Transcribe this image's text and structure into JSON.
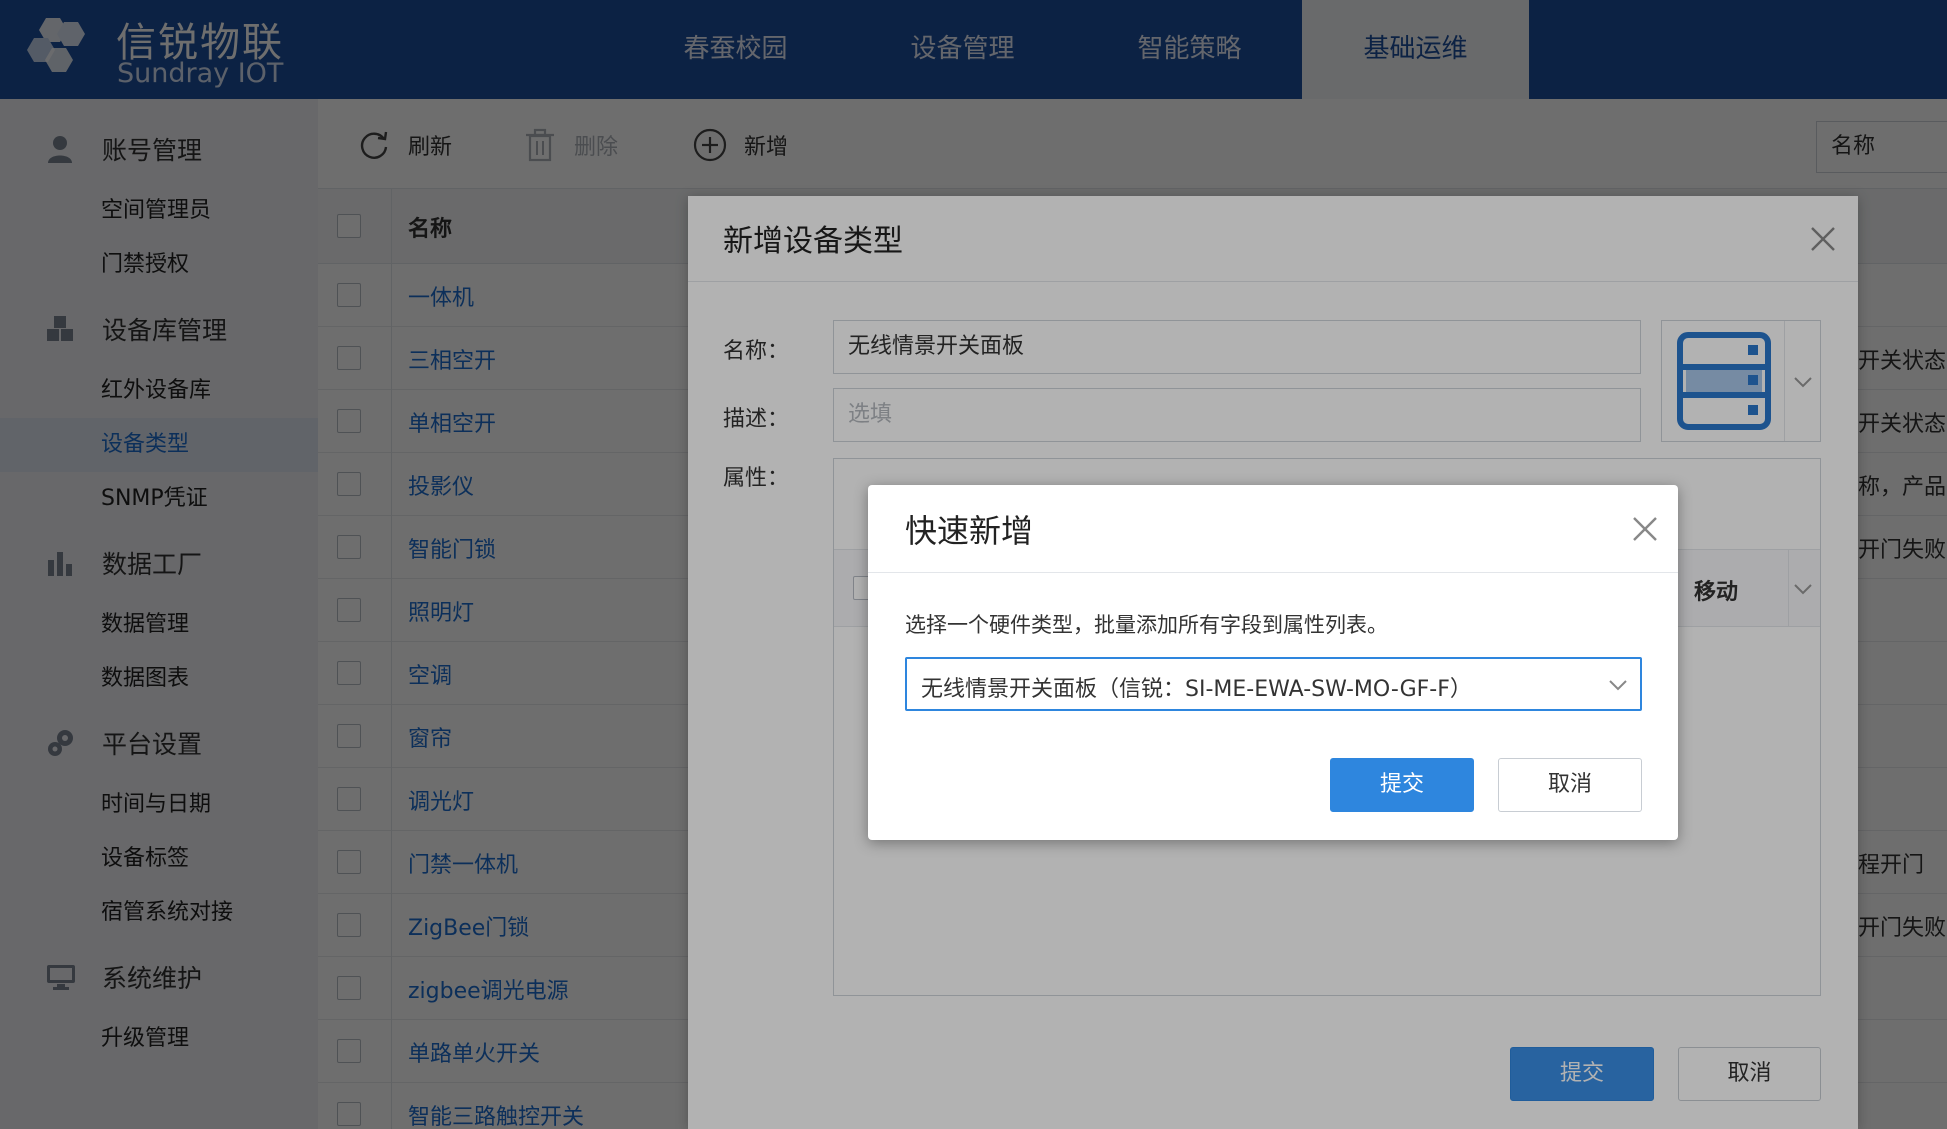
{
  "brand": {
    "title": "信锐物联",
    "subtitle": "Sundray IOT"
  },
  "nav": [
    "春蚕校园",
    "设备管理",
    "智能策略",
    "基础运维"
  ],
  "sidebar": {
    "groups": [
      {
        "label": "账号管理",
        "icon": "user-icon",
        "items": [
          "空间管理员",
          "门禁授权"
        ]
      },
      {
        "label": "设备库管理",
        "icon": "cubes-icon",
        "items": [
          "红外设备库",
          "设备类型",
          "SNMP凭证"
        ]
      },
      {
        "label": "数据工厂",
        "icon": "chart-icon",
        "items": [
          "数据管理",
          "数据图表"
        ]
      },
      {
        "label": "平台设置",
        "icon": "gears-icon",
        "items": [
          "时间与日期",
          "设备标签",
          "宿管系统对接"
        ]
      },
      {
        "label": "系统维护",
        "icon": "monitor-icon",
        "items": [
          "升级管理"
        ]
      }
    ]
  },
  "toolbar": {
    "refresh": "刷新",
    "delete": "删除",
    "add": "新增",
    "search_field": "名称"
  },
  "table": {
    "header_name": "名称",
    "rows": [
      {
        "name": "一体机",
        "right": ""
      },
      {
        "name": "三相空开",
        "right": "开关状态,"
      },
      {
        "name": "单相空开",
        "right": "开关状态,"
      },
      {
        "name": "投影仪",
        "right": "称，产品型"
      },
      {
        "name": "智能门锁",
        "right": "开门失败告"
      },
      {
        "name": "照明灯",
        "right": ""
      },
      {
        "name": "空调",
        "right": ""
      },
      {
        "name": "窗帘",
        "right": ""
      },
      {
        "name": "调光灯",
        "right": ""
      },
      {
        "name": "门禁一体机",
        "right": "程开门"
      },
      {
        "name": "ZigBee门锁",
        "right": "开门失败告"
      },
      {
        "name": "zigbee调光电源",
        "right": ""
      },
      {
        "name": "单路单火开关",
        "right": ""
      },
      {
        "name": "智能三路触控开关",
        "right": ""
      }
    ]
  },
  "dialog_add_type": {
    "title": "新增设备类型",
    "name_label": "名称：",
    "name_value": "无线情景开关面板",
    "desc_label": "描述：",
    "desc_placeholder": "选填",
    "attr_label": "属性：",
    "attr_col_move": "移动",
    "submit": "提交",
    "cancel": "取消"
  },
  "dialog_quick_add": {
    "title": "快速新增",
    "description": "选择一个硬件类型，批量添加所有字段到属性列表。",
    "selected": "无线情景开关面板（信锐：SI-ME-EWA-SW-MO-GF-F）",
    "submit": "提交",
    "cancel": "取消"
  },
  "colors": {
    "brand": "#1e4f9e",
    "primary": "#2e86de",
    "link": "#1e6fd0"
  }
}
